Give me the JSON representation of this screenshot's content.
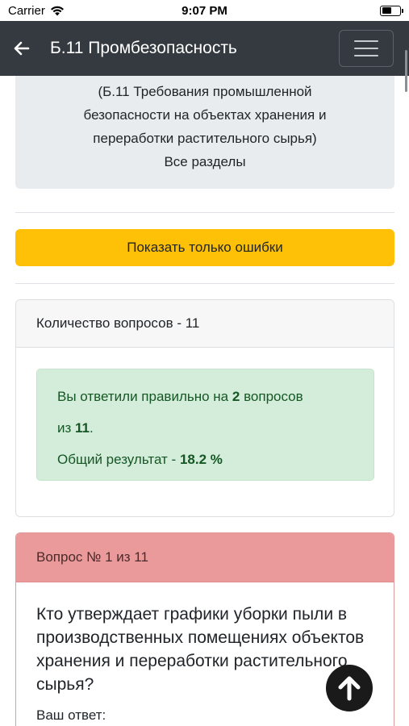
{
  "status": {
    "carrier": "Carrier",
    "time": "9:07 PM"
  },
  "navbar": {
    "title": "Б.11 Промбезопасность"
  },
  "info": {
    "line1": "(Б.11 Требования промышленной",
    "line2": "безопасности на объектах хранения и",
    "line3": "переработки растительного сырья)",
    "line4": "Все разделы"
  },
  "actions": {
    "show_errors_label": "Показать только ошибки"
  },
  "summary": {
    "header": "Количество вопросов - 11",
    "answered_prefix": "Вы ответили правильно на",
    "correct_count": "2",
    "answered_middle": "вопросов",
    "from_word": "из",
    "total_count": "11",
    "period": ".",
    "result_label": "Общий результат -",
    "result_value": "18.2 %"
  },
  "question": {
    "header": "Вопрос № 1 из 11",
    "text": "Кто утверждает графики уборки пыли в производственных помещениях объектов хранения и переработки растительного сырья?",
    "answer_label": "Ваш ответ:"
  },
  "colors": {
    "navbar": "#343a40",
    "warning": "#ffc107",
    "success_bg": "#d4edda",
    "success_text": "#155724",
    "danger_header": "#ea9a9a"
  },
  "icons": {
    "back": "arrow-left-icon",
    "menu": "hamburger-icon",
    "scroll_up": "arrow-up-icon"
  }
}
